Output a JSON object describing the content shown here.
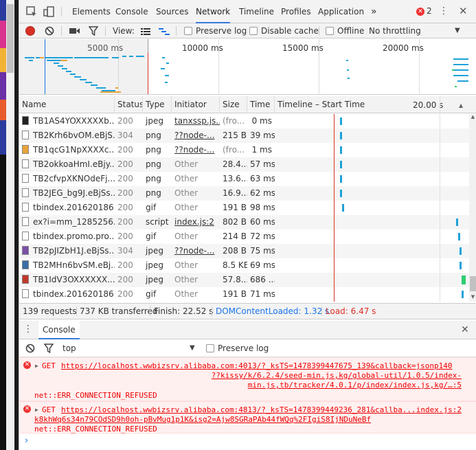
{
  "tabs": [
    "Elements",
    "Console",
    "Sources",
    "Network",
    "Timeline",
    "Profiles",
    "Application"
  ],
  "more_tabs": "»",
  "error_count": "2",
  "netbar": {
    "view_label": "View:",
    "preserve_log": "Preserve log",
    "disable_cache": "Disable cache",
    "offline": "Offline",
    "throttling": "No throttling"
  },
  "overview_ticks": [
    "5000 ms",
    "10000 ms",
    "15000 ms",
    "20000 ms"
  ],
  "columns": [
    "Name",
    "Status",
    "Type",
    "Initiator",
    "Size",
    "Time",
    "Timeline – Start Time"
  ],
  "timeline_tick": "20.00 s",
  "rows": [
    {
      "name": "TB1AS4YOXXXXXb...",
      "status": "200",
      "type": "jpeg",
      "initiator": "tanxssp.js...",
      "size": "(fro...",
      "time": "0 ms",
      "bar": 0.35
    },
    {
      "name": "TB2Krh6bvOM.eBjS...",
      "status": "304",
      "type": "png",
      "initiator": "??node-...",
      "size": "215 B",
      "time": "39 ms",
      "bar": 0.35
    },
    {
      "name": "TB1qcG1NpXXXXc...",
      "status": "200",
      "type": "png",
      "initiator": "??node-...",
      "size": "(fro...",
      "time": "1 ms",
      "bar": 0.35
    },
    {
      "name": "TB2okkoaHmI.eBjy...",
      "status": "200",
      "type": "png",
      "initiator": "Other",
      "size": "28.4...",
      "time": "57 ms",
      "bar": 0.35
    },
    {
      "name": "TB2cfvpXKNOdeFj...",
      "status": "200",
      "type": "png",
      "initiator": "Other",
      "size": "13.6...",
      "time": "63 ms",
      "bar": 0.35
    },
    {
      "name": "TB2JEG_bg9J.eBjSs...",
      "status": "200",
      "type": "png",
      "initiator": "Other",
      "size": "16.9...",
      "time": "62 ms",
      "bar": 0.35
    },
    {
      "name": "tbindex.201620186...",
      "status": "200",
      "type": "gif",
      "initiator": "Other",
      "size": "191 B",
      "time": "98 ms",
      "bar": 0.36
    },
    {
      "name": "ex?i=mm_1285256...",
      "status": "200",
      "type": "script",
      "initiator": "index.js:2",
      "size": "802 B",
      "time": "60 ms",
      "bar": 0.97
    },
    {
      "name": "tbindex.promo.pro...",
      "status": "200",
      "type": "gif",
      "initiator": "Other",
      "size": "214 B",
      "time": "72 ms",
      "bar": 0.98
    },
    {
      "name": "TB2pJIZbH1J.eBjSs...",
      "status": "304",
      "type": "jpeg",
      "initiator": "??node-...",
      "size": "208 B",
      "time": "75 ms",
      "bar": 0.99
    },
    {
      "name": "TB2MHn6bvSM.eBj...",
      "status": "200",
      "type": "jpeg",
      "initiator": "Other",
      "size": "8.5 KB",
      "time": "69 ms",
      "bar": 0.99
    },
    {
      "name": "TB1IdV3OXXXXXX...",
      "status": "200",
      "type": "jpeg",
      "initiator": "Other",
      "size": "57.8...",
      "time": "686 ...",
      "bar": 1.0
    },
    {
      "name": "tbindex.201620186...",
      "status": "200",
      "type": "gif",
      "initiator": "Other",
      "size": "191 B",
      "time": "71 ms",
      "bar": 1.0
    }
  ],
  "statusbar": {
    "requests": "139 requests",
    "transferred": "737 KB transferred",
    "finish": "Finish: 22.52 s",
    "dcl": "DOMContentLoaded: 1.32 s",
    "load": "Load: 6.47 s"
  },
  "drawer": {
    "tab": "Console",
    "context": "top",
    "preserve_log": "Preserve log"
  },
  "messages": [
    {
      "prefix": "GET",
      "lines": [
        "https://localhost.wwbizsrv.alibaba.com:4013/?_ksTS=1478399447675_139&callback=jsonp140",
        "??kissy/k/6.2.4/seed-min.js,kg/global-util/1.0.5/index-",
        "min.js,tb/tracker/4.0.1/p/index/index.js,kg/…:5"
      ],
      "error": "net::ERR_CONNECTION_REFUSED"
    },
    {
      "prefix": "GET",
      "lines": [
        "https://localhost.wwbizsrv.alibaba.com:4813/?_ksTS=1478399449236_281&callba...",
        "k8khWq6s34n79COdSD9h0oh-pBvMug1p1K&isg2=Ajw8SGRaPAb44fWQq%2FIgiS8IjNDuNeBf"
      ],
      "source": "index.js:2",
      "error": "net::ERR_CONNECTION_REFUSED"
    }
  ],
  "prompt": "›",
  "colors": {
    "accent": "#3879d9",
    "error": "#e00",
    "bar": "#1da1d9",
    "dcl": "#1a73e8",
    "load": "#d93025"
  }
}
